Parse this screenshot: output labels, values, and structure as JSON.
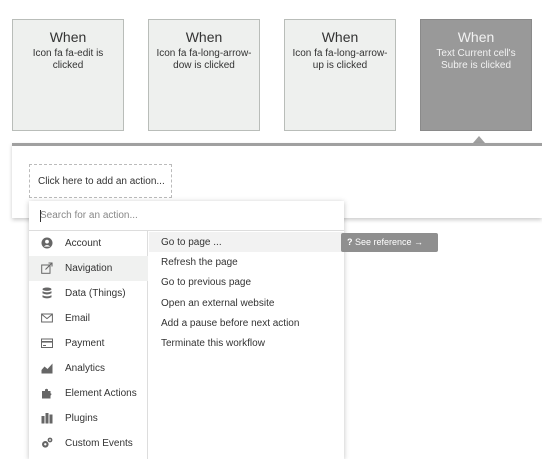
{
  "events": [
    {
      "when": "When",
      "desc": "Icon fa fa-edit is clicked"
    },
    {
      "when": "When",
      "desc": "Icon fa fa-long-arrow-dow is clicked"
    },
    {
      "when": "When",
      "desc": "Icon fa fa-long-arrow-up is clicked"
    },
    {
      "when": "When",
      "desc": "Text Current cell's Subre is clicked",
      "active": true
    }
  ],
  "panel": {
    "add_action": "Click here to add an action..."
  },
  "dropdown": {
    "search_placeholder": "Search for an action...",
    "categories": [
      {
        "label": "Account",
        "icon": "account-icon"
      },
      {
        "label": "Navigation",
        "icon": "navigation-icon",
        "selected": true
      },
      {
        "label": "Data (Things)",
        "icon": "database-icon"
      },
      {
        "label": "Email",
        "icon": "email-icon"
      },
      {
        "label": "Payment",
        "icon": "payment-icon"
      },
      {
        "label": "Analytics",
        "icon": "analytics-icon"
      },
      {
        "label": "Element Actions",
        "icon": "element-actions-icon"
      },
      {
        "label": "Plugins",
        "icon": "plugins-icon"
      },
      {
        "label": "Custom Events",
        "icon": "custom-events-icon"
      }
    ],
    "actions": [
      "Go to page ...",
      "Refresh the page",
      "Go to previous page",
      "Open an external website",
      "Add a pause before next action",
      "Terminate this workflow"
    ]
  },
  "reference": {
    "icon": "?",
    "label": "See reference →"
  },
  "colors": {
    "active_card": "#999999",
    "card": "#eef0ee",
    "tooltip": "#8f8f8f"
  }
}
